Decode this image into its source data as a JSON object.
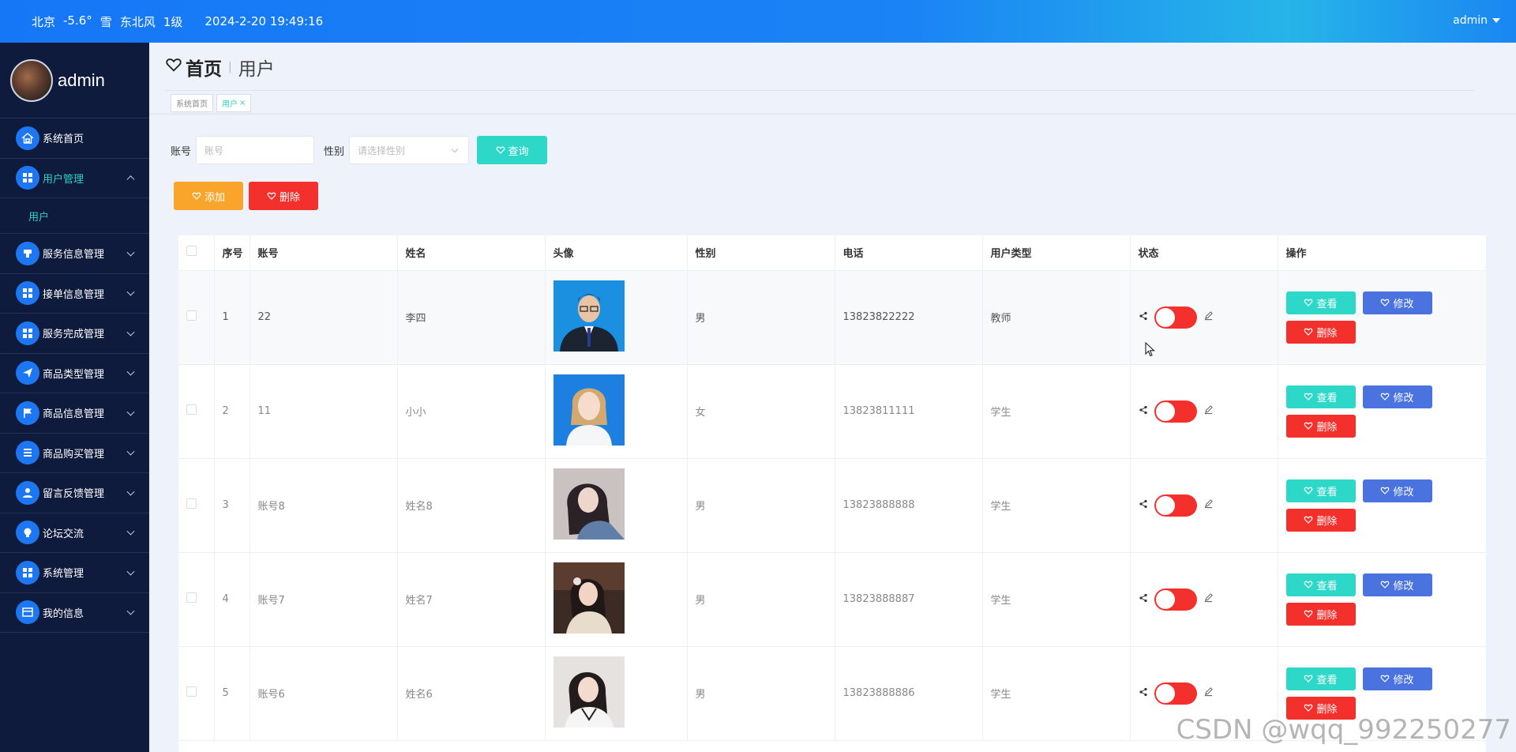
{
  "topbar": {
    "city": "北京",
    "temp": "-5.6°",
    "weather": "雪",
    "wind": "东北风",
    "level": "1级",
    "datetime": "2024-2-20 19:49:16",
    "user": "admin"
  },
  "sidebar": {
    "username": "admin",
    "items": [
      {
        "label": "系统首页",
        "icon": "home-icon"
      },
      {
        "label": "用户管理",
        "icon": "grid-icon",
        "expanded": true
      },
      {
        "label": "服务信息管理",
        "icon": "service-icon"
      },
      {
        "label": "接单信息管理",
        "icon": "grid-icon"
      },
      {
        "label": "服务完成管理",
        "icon": "grid-icon"
      },
      {
        "label": "商品类型管理",
        "icon": "send-icon"
      },
      {
        "label": "商品信息管理",
        "icon": "flag-icon"
      },
      {
        "label": "商品购买管理",
        "icon": "list-icon"
      },
      {
        "label": "留言反馈管理",
        "icon": "person-icon"
      },
      {
        "label": "论坛交流",
        "icon": "bulb-icon"
      },
      {
        "label": "系统管理",
        "icon": "grid-icon"
      },
      {
        "label": "我的信息",
        "icon": "card-icon"
      }
    ],
    "sub_items": [
      "用户"
    ]
  },
  "header": {
    "home": "首页",
    "current": "用户",
    "tags": [
      {
        "label": "系统首页"
      },
      {
        "label": "用户",
        "close": "×"
      }
    ]
  },
  "search": {
    "account_label": "账号",
    "account_placeholder": "账号",
    "gender_label": "性别",
    "gender_placeholder": "请选择性别",
    "query_label": "查询"
  },
  "actions": {
    "add_label": "添加",
    "delete_label": "删除"
  },
  "table": {
    "columns": [
      "序号",
      "账号",
      "姓名",
      "头像",
      "性别",
      "电话",
      "用户类型",
      "状态",
      "操作"
    ],
    "rows": [
      {
        "no": "1",
        "account": "22",
        "name": "李四",
        "gender": "男",
        "phone": "13823822222",
        "type": "教师"
      },
      {
        "no": "2",
        "account": "11",
        "name": "小小",
        "gender": "女",
        "phone": "13823811111",
        "type": "学生"
      },
      {
        "no": "3",
        "account": "账号8",
        "name": "姓名8",
        "gender": "男",
        "phone": "13823888888",
        "type": "学生"
      },
      {
        "no": "4",
        "account": "账号7",
        "name": "姓名7",
        "gender": "男",
        "phone": "13823888887",
        "type": "学生"
      },
      {
        "no": "5",
        "account": "账号6",
        "name": "姓名6",
        "gender": "男",
        "phone": "13823888886",
        "type": "学生"
      }
    ],
    "op_view": "查看",
    "op_edit": "修改",
    "op_delete": "删除"
  },
  "watermark": "CSDN @wqq_992250277"
}
